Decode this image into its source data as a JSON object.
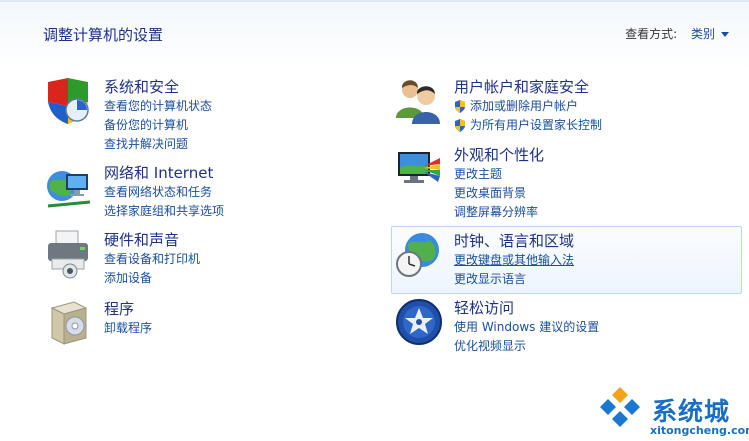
{
  "header": {
    "title": "调整计算机的设置",
    "view_by_label": "查看方式:",
    "view_by_value": "类别"
  },
  "categories": {
    "security": {
      "title": "系统和安全",
      "links": [
        "查看您的计算机状态",
        "备份您的计算机",
        "查找并解决问题"
      ]
    },
    "network": {
      "title": "网络和 Internet",
      "links": [
        "查看网络状态和任务",
        "选择家庭组和共享选项"
      ]
    },
    "hardware": {
      "title": "硬件和声音",
      "links": [
        "查看设备和打印机",
        "添加设备"
      ]
    },
    "programs": {
      "title": "程序",
      "links": [
        "卸载程序"
      ]
    },
    "users": {
      "title": "用户帐户和家庭安全",
      "links": [
        "添加或删除用户帐户",
        "为所有用户设置家长控制"
      ]
    },
    "appearance": {
      "title": "外观和个性化",
      "links": [
        "更改主题",
        "更改桌面背景",
        "调整屏幕分辨率"
      ]
    },
    "clock": {
      "title": "时钟、语言和区域",
      "links": [
        "更改键盘或其他输入法",
        "更改显示语言"
      ]
    },
    "ease": {
      "title": "轻松访问",
      "links": [
        "使用 Windows 建议的设置",
        "优化视频显示"
      ]
    }
  },
  "watermark": {
    "name": "系统城",
    "url": "xitongcheng.com"
  }
}
